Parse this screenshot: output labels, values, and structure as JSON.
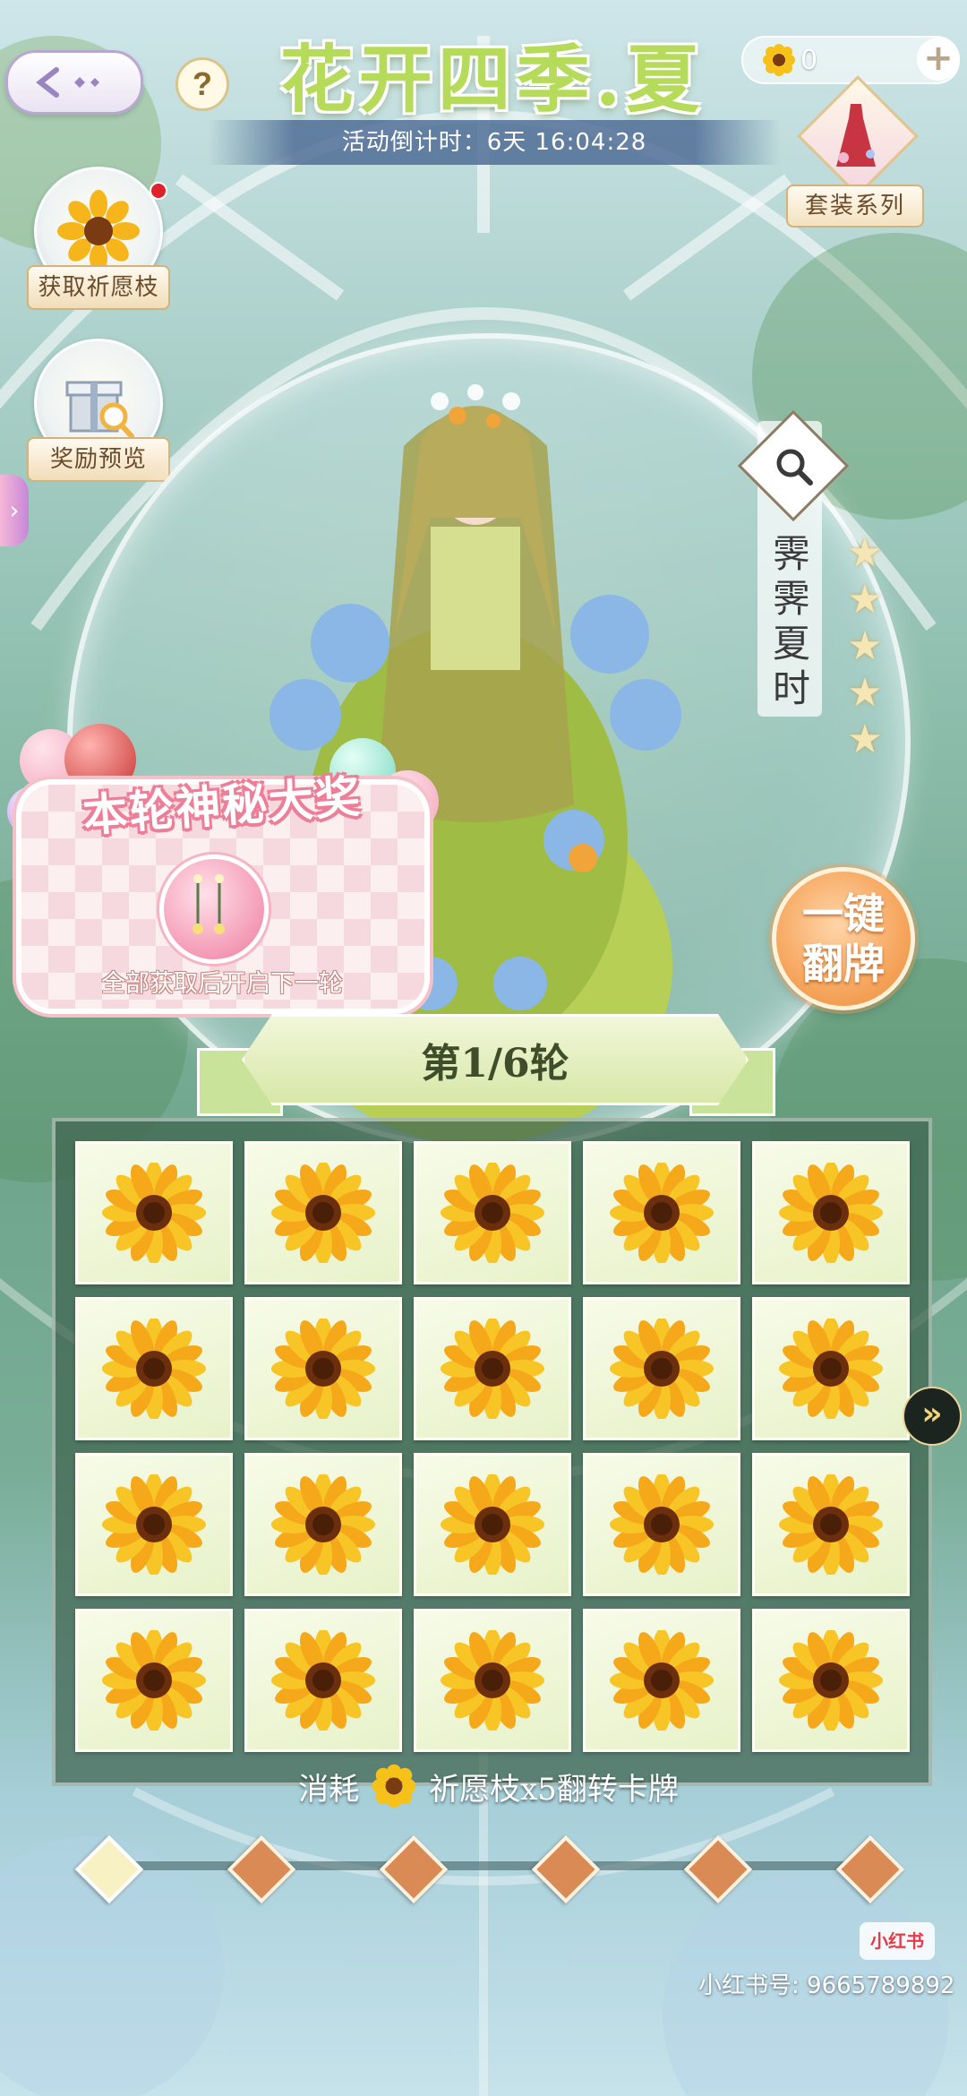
{
  "header": {
    "title": "花开四季.夏",
    "countdown_label": "活动倒计时：",
    "countdown_value": "6天 16:04:28",
    "help": "?",
    "currency": {
      "icon": "sunflower-icon",
      "value": "0",
      "add": "+"
    }
  },
  "left_buttons": {
    "get_wish_branch": "获取祈愿枝",
    "reward_preview": "奖励预览"
  },
  "suit_series": {
    "label": "套装系列"
  },
  "outfit": {
    "name": "霁霁夏时",
    "stars": 5
  },
  "one_key_flip": {
    "label": "一键翻牌"
  },
  "mystery_prize": {
    "title": "本轮神秘大奖",
    "note": "全部获取后开启下一轮"
  },
  "round": {
    "label": "第1/6轮",
    "current": 1,
    "total": 6
  },
  "cards": {
    "rows": 4,
    "cols": 5,
    "card_icon": "sunflower-icon",
    "next_icon": "double-chevron-right-icon"
  },
  "cost": {
    "prefix": "消耗",
    "suffix": "祈愿枝x5翻转卡牌"
  },
  "progress": {
    "nodes": 6,
    "active_index": 0
  },
  "watermark": {
    "logo": "小红书",
    "id": "小红书号: 9665789892"
  },
  "colors": {
    "title": "#b6db5a",
    "node": "#d98a55",
    "board": "#3f634e",
    "onekey": "#f6a65e"
  }
}
